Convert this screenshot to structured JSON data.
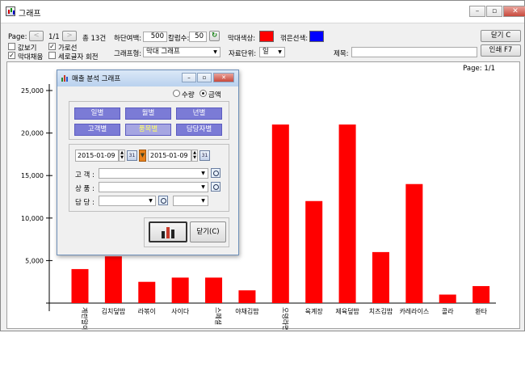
{
  "window": {
    "title": "그래프"
  },
  "toolbar": {
    "page_label": "Page:",
    "page_num": "1/1",
    "total": "총 13건",
    "bottom_margin_label": "하단여백:",
    "bottom_margin_value": "500",
    "col_width_label": "칼럼수:",
    "col_width_value": "50",
    "bar_color_label": "막대색상:",
    "line_color_label": "꺾은선색:",
    "close_button": "닫기 C",
    "print_button": "인쇄 F7",
    "check_show_values": "값보기",
    "check_horizontal": "가로선",
    "check_fill_bars": "막대채움",
    "check_vertical_text": "세로글자 회전",
    "graph_type_label": "그래프형:",
    "graph_type_value": "막대 그래프",
    "data_unit_label": "자료단위:",
    "data_unit_value": "일",
    "title_label": "제목:",
    "title_value": ""
  },
  "colors": {
    "bar": "#ff0000",
    "line": "#0000ff"
  },
  "chart_page": "Page: 1/1",
  "chart_data": {
    "type": "bar",
    "categories": [
      "계란말이",
      "김치덮밥",
      "라볶이",
      "사이다",
      "스페셜",
      "야채김밥",
      "오뎅라면",
      "육계장",
      "제육덮밥",
      "치즈김밥",
      "카레라이스",
      "콜라",
      "환타"
    ],
    "values": [
      4000,
      5500,
      2500,
      3000,
      3000,
      1500,
      21000,
      12000,
      21000,
      6000,
      14000,
      1000,
      2000
    ],
    "yticks": [
      "5,000",
      "10,000",
      "15,000",
      "20,000",
      "25,000"
    ],
    "ylim": [
      0,
      25000
    ],
    "grid": false,
    "color": "#ff0000"
  },
  "dialog": {
    "title": "매출 분석 그래프",
    "radio_qty": "수량",
    "radio_amount": "금액",
    "tabs": [
      "일별",
      "월별",
      "년별",
      "고객별",
      "품목별",
      "담당자별"
    ],
    "date_from": "2015-01-09",
    "date_to": "2015-01-09",
    "customer_label": "고  객 :",
    "product_label": "상  품 :",
    "manager_label": "담  당 :",
    "close_button": "닫기(C)"
  }
}
